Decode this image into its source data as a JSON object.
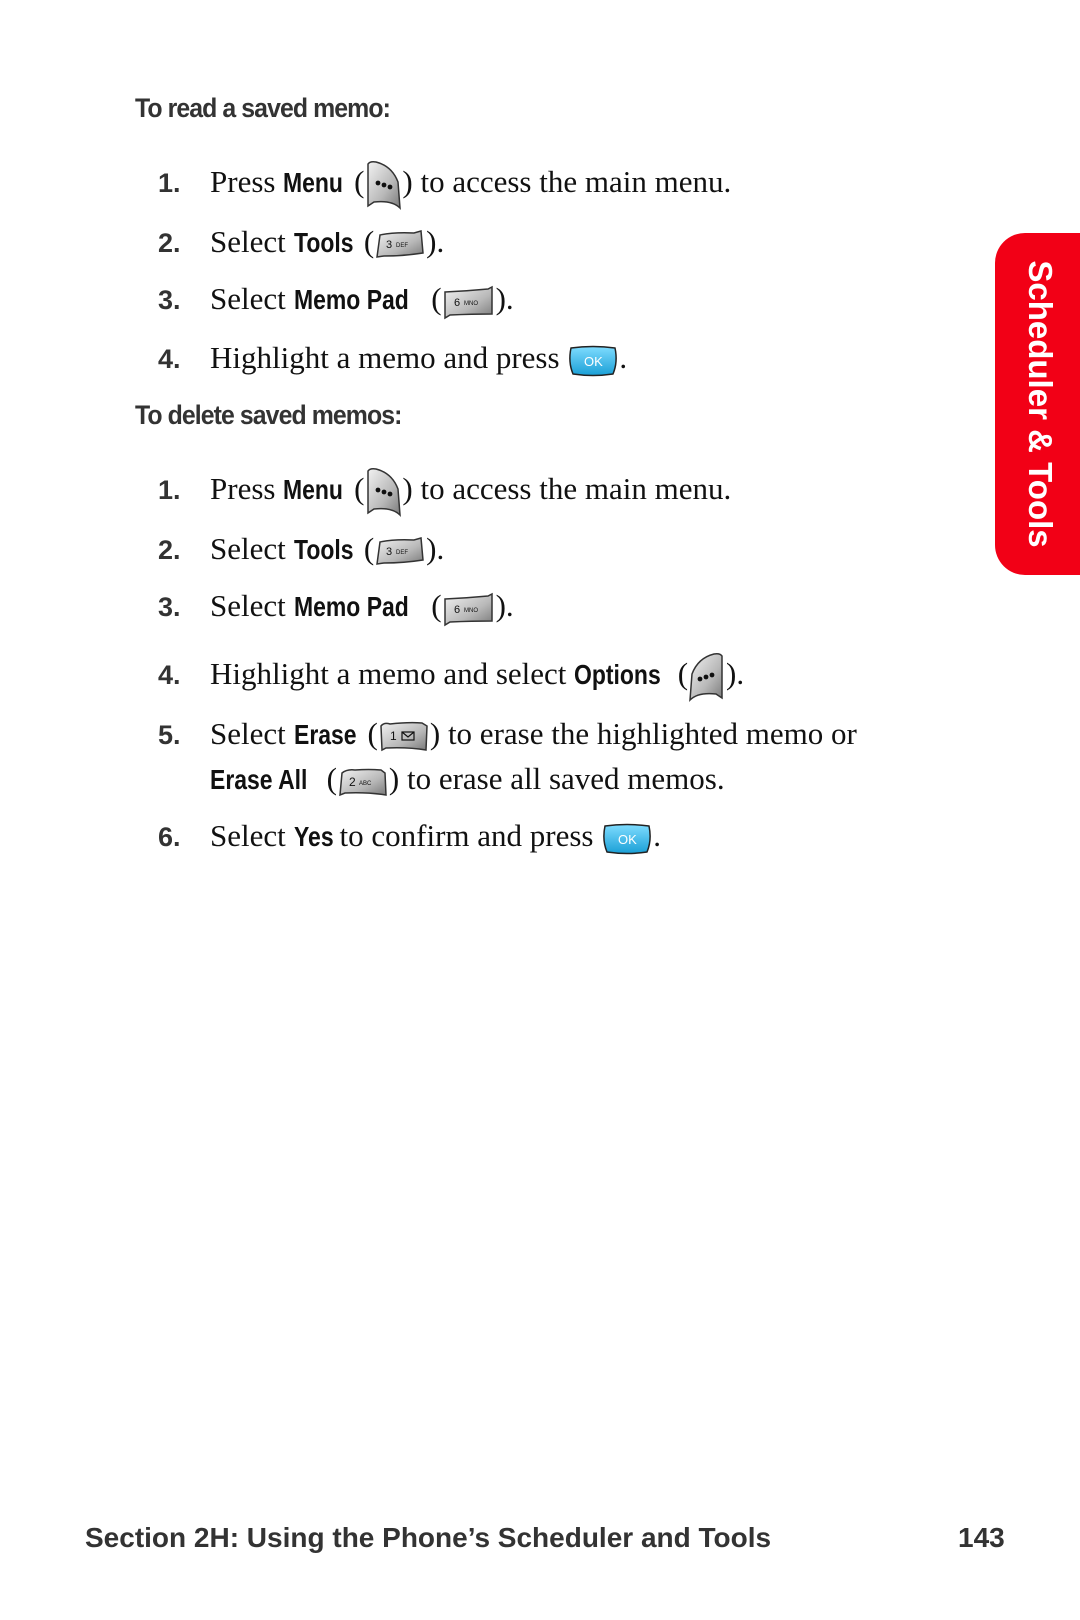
{
  "side_tab": {
    "label": "Scheduler & Tools",
    "color": "#f20016"
  },
  "read_section": {
    "heading": "To read a saved memo:",
    "steps": [
      {
        "num": "1.",
        "pre": "Press ",
        "kw": "Menu",
        "mid": " (",
        "key": "menu-key",
        "post": ") to access the main menu."
      },
      {
        "num": "2.",
        "pre": "Select ",
        "kw": "Tools",
        "mid": " (",
        "key": "3 DEF",
        "post": ")."
      },
      {
        "num": "3.",
        "pre": "Select ",
        "kw": "Memo Pad",
        "mid": " (",
        "key": "6 MNO",
        "post": ")."
      },
      {
        "num": "4.",
        "pre": "Highlight a memo and press ",
        "key": "OK",
        "post": "."
      }
    ]
  },
  "delete_section": {
    "heading": "To delete saved memos:",
    "steps": [
      {
        "num": "1.",
        "pre": "Press ",
        "kw": "Menu",
        "mid": " (",
        "key": "menu-key",
        "post": ") to access the main menu."
      },
      {
        "num": "2.",
        "pre": "Select ",
        "kw": "Tools",
        "mid": " (",
        "key": "3 DEF",
        "post": ")."
      },
      {
        "num": "3.",
        "pre": "Select ",
        "kw": "Memo Pad",
        "mid": " (",
        "key": "6 MNO",
        "post": ")."
      },
      {
        "num": "4.",
        "pre": "Highlight a memo and select ",
        "kw": "Options",
        "mid": " (",
        "key": "options-key",
        "post": ")."
      },
      {
        "num": "5.",
        "pre": "Select ",
        "kw": "Erase",
        "mid": " (",
        "key": "1",
        "post": ") to erase the highlighted memo or"
      },
      {
        "cont_kw": "Erase All",
        "cont_mid": " (",
        "key": "2 ABC",
        "cont_post": ") to erase all saved memos."
      },
      {
        "num": "6.",
        "pre": "Select ",
        "kw": "Yes",
        "mid": " to confirm and press ",
        "key": "OK",
        "post": "."
      }
    ]
  },
  "keys": {
    "three": {
      "digit": "3",
      "letters": "DEF"
    },
    "six": {
      "digit": "6",
      "letters": "MNO"
    },
    "one": {
      "digit": "1"
    },
    "two": {
      "digit": "2",
      "letters": "ABC"
    },
    "ok": {
      "label": "OK",
      "color": "#2bb8e8"
    }
  },
  "footer": {
    "section": "Section 2H: Using the Phone’s Scheduler and Tools",
    "page": "143"
  }
}
